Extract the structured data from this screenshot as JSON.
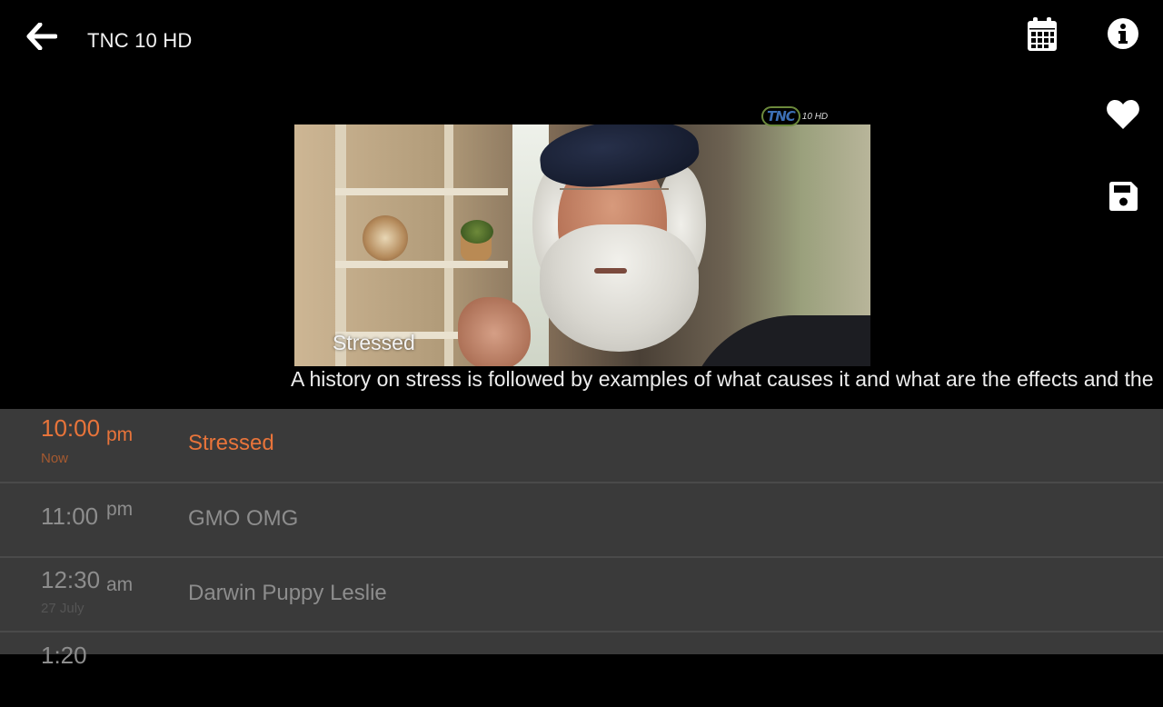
{
  "header": {
    "channel_title": "TNC 10 HD"
  },
  "actions": {
    "back": "arrow-left-icon",
    "schedule": "calendar-icon",
    "info": "info-circle-icon",
    "favorite": "heart-icon",
    "record": "floppy-disk-icon"
  },
  "player": {
    "logo_mark": "TNC",
    "logo_suffix": "10 HD",
    "caption": "Stressed",
    "description": "A history on stress is followed by examples of what causes it and what are the effects and the"
  },
  "schedule": [
    {
      "time": "10:00",
      "ampm": "pm",
      "sub": "Now",
      "title": "Stressed",
      "current": true
    },
    {
      "time": "11:00",
      "ampm": "pm",
      "sub": "",
      "title": "GMO OMG",
      "current": false
    },
    {
      "time": "12:30",
      "ampm": "am",
      "sub": "27 July",
      "title": "Darwin Puppy Leslie",
      "current": false
    },
    {
      "time": "1:20",
      "ampm": "",
      "sub": "",
      "title": "",
      "current": false
    }
  ],
  "colors": {
    "accent": "#e8743a",
    "schedule_bg": "#3a3a3a",
    "muted_text": "#8d8d8d"
  }
}
